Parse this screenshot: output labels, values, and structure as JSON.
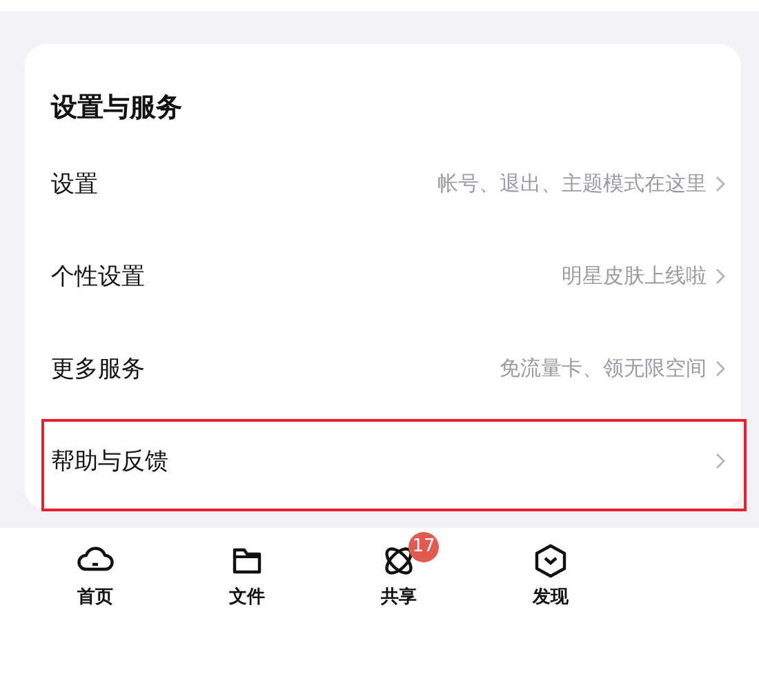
{
  "section": {
    "title": "设置与服务",
    "items": [
      {
        "label": "设置",
        "hint": "帐号、退出、主题模式在这里",
        "highlighted": false
      },
      {
        "label": "个性设置",
        "hint": "明星皮肤上线啦",
        "highlighted": false
      },
      {
        "label": "更多服务",
        "hint": "免流量卡、领无限空间",
        "highlighted": false
      },
      {
        "label": "帮助与反馈",
        "highlighted": true
      }
    ]
  },
  "tab_bar": [
    {
      "kind": "home",
      "label": "首页"
    },
    {
      "kind": "files",
      "label": "文件"
    },
    {
      "kind": "share",
      "label": "共享",
      "badge": "17"
    },
    {
      "kind": "discover",
      "label": "发现"
    }
  ]
}
